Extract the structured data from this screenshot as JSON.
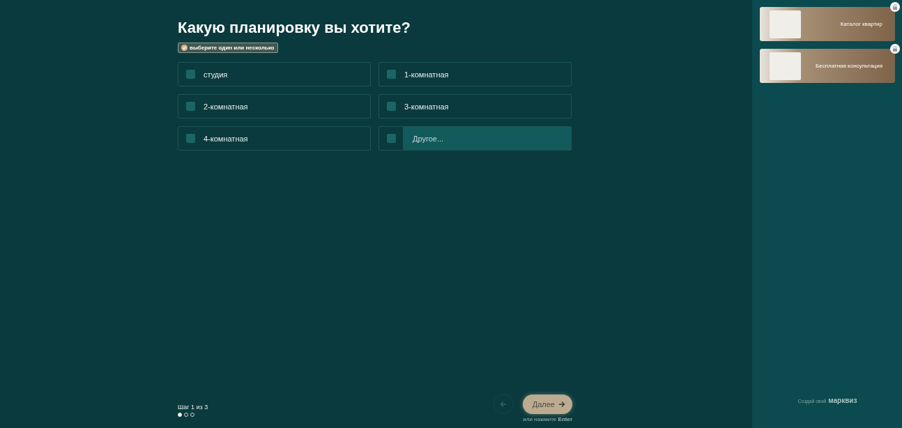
{
  "question": {
    "title": "Какую планировку вы хотите?",
    "hint": "выберите один или несколько"
  },
  "options": [
    {
      "kind": "option",
      "label": "студия",
      "checked": false
    },
    {
      "kind": "option",
      "label": "1-комнатная",
      "checked": false
    },
    {
      "kind": "option",
      "label": "2-комнатная",
      "checked": false
    },
    {
      "kind": "option",
      "label": "3-комнатная",
      "checked": false
    },
    {
      "kind": "option",
      "label": "4-комнатная",
      "checked": false
    },
    {
      "kind": "other",
      "placeholder": "Другое...",
      "checked": false
    }
  ],
  "footer": {
    "step": "Шаг 1 из 3",
    "step_dots": [
      {
        "selected": true
      },
      {
        "selected": false
      },
      {
        "selected": false
      }
    ],
    "next": "Далее",
    "enter_hint": "или нажмите **Enter**"
  },
  "sidebar": {
    "bonuses": [
      {
        "label": "Каталог квартир",
        "locked": true
      },
      {
        "label": "Бесплатная консультация",
        "locked": true
      }
    ],
    "credit": "Создай свой",
    "brand": "марквиз"
  }
}
